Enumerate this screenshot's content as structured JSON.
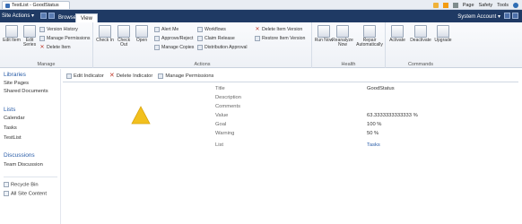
{
  "browser": {
    "tab_title": "TestList - GoodStatus",
    "menu": [
      "Page",
      "Safety",
      "Tools"
    ]
  },
  "topbar": {
    "site_actions": "Site Actions",
    "tabs": [
      "Browse",
      "View"
    ],
    "active_tab": "View",
    "user": "System Account"
  },
  "ribbon": {
    "manage": {
      "label": "Manage",
      "edit_item": "Edit Item",
      "edit_series": "Edit Series",
      "version_history": "Version History",
      "manage_permissions": "Manage Permissions",
      "delete_item": "Delete Item"
    },
    "actions": {
      "label": "Actions",
      "check_in": "Check In",
      "check_out": "Check Out",
      "open": "Open",
      "alert_me": "Alert Me",
      "approve_reject": "Approve/Reject",
      "manage_copies": "Manage Copies",
      "workflows": "Workflows",
      "claim_release": "Claim Release",
      "distribution_approval": "Distribution Approval",
      "delete_item_version": "Delete Item Version",
      "restore_item_version": "Restore Item Version"
    },
    "health": {
      "label": "Health",
      "run_now": "Run Now",
      "reanalyze_now": "Reanalyze Now",
      "repair_automatically": "Repair Automatically"
    },
    "commands": {
      "label": "Commands",
      "activate": "Activate",
      "deactivate": "Deactivate",
      "upgrade": "Upgrade"
    }
  },
  "leftnav": {
    "libraries": "Libraries",
    "site_pages": "Site Pages",
    "shared_documents": "Shared Documents",
    "lists": "Lists",
    "calendar": "Calendar",
    "tasks": "Tasks",
    "testlist": "TestList",
    "discussions": "Discussions",
    "team_discussion": "Team Discussion",
    "recycle_bin": "Recycle Bin",
    "all_site_content": "All Site Content"
  },
  "toolbar": {
    "edit_indicator": "Edit Indicator",
    "delete_indicator": "Delete Indicator",
    "manage_permissions": "Manage Permissions"
  },
  "fields": {
    "title_label": "Title",
    "title_value": "GoodStatus",
    "description_label": "Description",
    "comments_label": "Comments",
    "value_label": "Value",
    "value_value": "63.3333333333333 %",
    "goal_label": "Goal",
    "goal_value": "100 %",
    "warning_label": "Warning",
    "warning_value": "50 %",
    "list_label": "List",
    "list_value": "Tasks"
  },
  "colors": {
    "topbar": "#1f3a64",
    "indicator": "#f2c01e",
    "link": "#2a5da8"
  },
  "icons": {
    "indicator": "warning-triangle-icon"
  }
}
